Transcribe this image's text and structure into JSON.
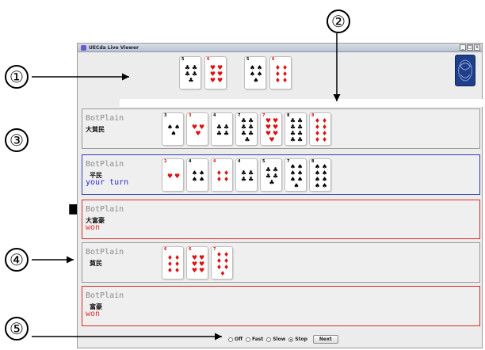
{
  "window": {
    "title": "UECda Live Viewer",
    "buttons": [
      "_",
      "□",
      "x"
    ]
  },
  "callouts": [
    "①",
    "②",
    "③",
    "④",
    "⑤"
  ],
  "field": {
    "cards": [
      {
        "rank": "5",
        "suit": "♣",
        "color": "black",
        "pips": 5
      },
      {
        "rank": "6",
        "suit": "♥",
        "color": "red",
        "pips": 6
      },
      {
        "rank": "5",
        "suit": "♠",
        "color": "black",
        "pips": 5
      },
      {
        "rank": "6",
        "suit": "♦",
        "color": "red",
        "pips": 6
      }
    ]
  },
  "players": [
    {
      "name": "BotPlain",
      "rank": "大貧民",
      "status": "",
      "state": "normal",
      "cards": [
        {
          "rank": "3",
          "suit": "♠",
          "color": "black",
          "pips": 3
        },
        {
          "rank": "3",
          "suit": "♥",
          "color": "red",
          "pips": 3
        },
        {
          "rank": "4",
          "suit": "♣",
          "color": "black",
          "pips": 4
        },
        {
          "rank": "7",
          "suit": "♣",
          "color": "black",
          "pips": 7
        },
        {
          "rank": "7",
          "suit": "♥",
          "color": "red",
          "pips": 7
        },
        {
          "rank": "8",
          "suit": "♣",
          "color": "black",
          "pips": 8
        },
        {
          "rank": "8",
          "suit": "♦",
          "color": "red",
          "pips": 8
        }
      ]
    },
    {
      "name": "BotPlain",
      "rank": "平民",
      "status": "your turn",
      "state": "active",
      "cards": [
        {
          "rank": "2",
          "suit": "♥",
          "color": "red",
          "pips": 2
        },
        {
          "rank": "4",
          "suit": "♠",
          "color": "black",
          "pips": 4
        },
        {
          "rank": "4",
          "suit": "♦",
          "color": "red",
          "pips": 4
        },
        {
          "rank": "4",
          "suit": "♣",
          "color": "black",
          "pips": 4
        },
        {
          "rank": "5",
          "suit": "♣",
          "color": "black",
          "pips": 5
        },
        {
          "rank": "7",
          "suit": "♠",
          "color": "black",
          "pips": 7
        },
        {
          "rank": "8",
          "suit": "♠",
          "color": "black",
          "pips": 8
        }
      ]
    },
    {
      "name": "BotPlain",
      "rank": "大富豪",
      "status": "won",
      "state": "won",
      "cards": []
    },
    {
      "name": "BotPlain",
      "rank": "貧民",
      "status": "",
      "state": "normal",
      "cards": [
        {
          "rank": "6",
          "suit": "♦",
          "color": "red",
          "pips": 6
        },
        {
          "rank": "6",
          "suit": "♥",
          "color": "red",
          "pips": 6
        },
        {
          "rank": "7",
          "suit": "♦",
          "color": "red",
          "pips": 7
        }
      ]
    },
    {
      "name": "BotPlain",
      "rank": "富豪",
      "status": "won",
      "state": "won",
      "cards": []
    }
  ],
  "speed": {
    "options": [
      "Off",
      "Fast",
      "Slow",
      "Stop"
    ],
    "selected": "Stop",
    "next_label": "Next"
  },
  "colors": {
    "active_border": "#2e3fb5",
    "won_border": "#d82a2a",
    "turn_text": "#2a2ad0",
    "won_text": "#e03030"
  }
}
